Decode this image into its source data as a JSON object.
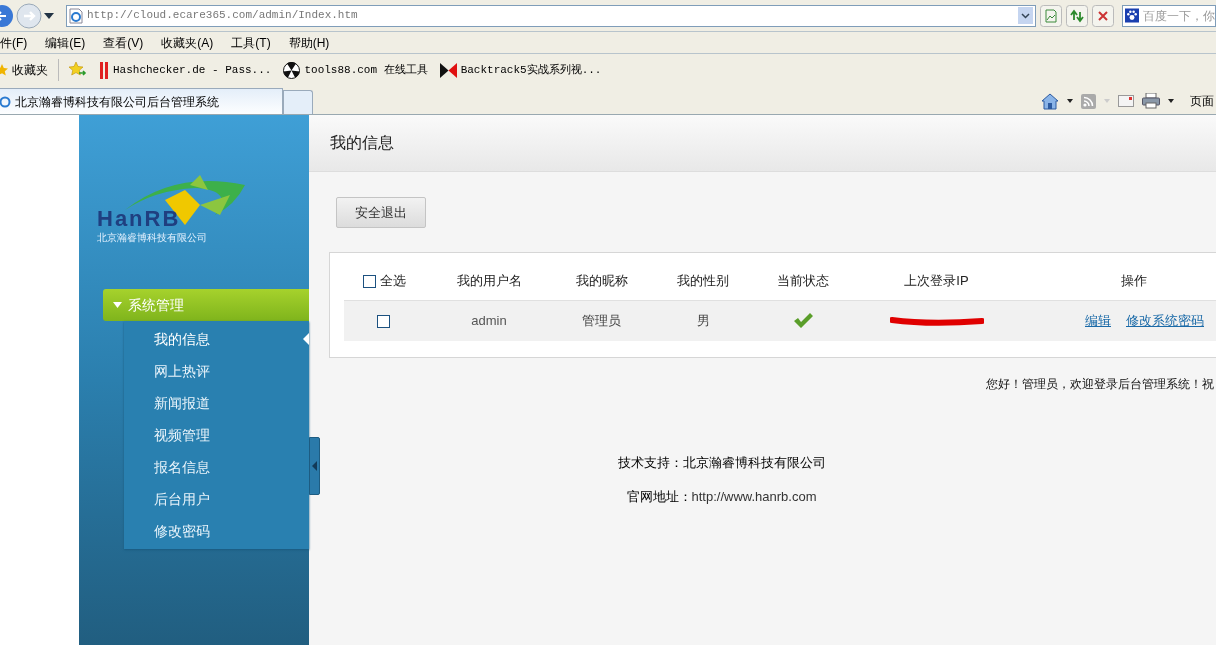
{
  "browser": {
    "address": "http://cloud.ecare365.com/admin/Index.htm",
    "search_placeholder": "百度一下，你",
    "menu": [
      "件(F)",
      "编辑(E)",
      "查看(V)",
      "收藏夹(A)",
      "工具(T)",
      "帮助(H)"
    ],
    "favorites_label": "收藏夹",
    "favorites": [
      "Hashchecker.de - Pass...",
      "tools88.com 在线工具",
      "Backtrack5实战系列视..."
    ],
    "tab": {
      "title": "北京瀚睿博科技有限公司后台管理系统",
      "selected": true
    },
    "page_menu": "页面"
  },
  "sidebar": {
    "logo_text": "HanRB",
    "logo_subtitle": "北京瀚睿博科技有限公司",
    "groups": [
      {
        "label": "系统管理",
        "expanded": true,
        "items": [
          {
            "label": "我的信息",
            "selected": true
          },
          {
            "label": "网上热评",
            "selected": false
          },
          {
            "label": "新闻报道",
            "selected": false
          },
          {
            "label": "视频管理",
            "selected": false
          },
          {
            "label": "报名信息",
            "selected": false
          },
          {
            "label": "后台用户",
            "selected": false
          },
          {
            "label": "修改密码",
            "selected": false
          }
        ]
      }
    ]
  },
  "main": {
    "title": "我的信息",
    "logout_button": "安全退出",
    "table": {
      "select_all": {
        "label": "全选",
        "checked": false
      },
      "columns": [
        "我的用户名",
        "我的昵称",
        "我的性别",
        "当前状态",
        "上次登录IP",
        "操作"
      ],
      "rows": [
        {
          "checked": false,
          "username": "admin",
          "nickname": "管理员",
          "gender": "男",
          "active": true,
          "ip_redacted": true,
          "actions": [
            "编辑",
            "修改系统密码"
          ]
        }
      ]
    },
    "welcome": "您好！管理员，欢迎登录后台管理系统！祝",
    "footer": [
      {
        "label": "技术支持：",
        "value": "北京瀚睿博科技有限公司"
      },
      {
        "label": "官网地址：",
        "value": "http://www.hanrb.com"
      }
    ]
  }
}
